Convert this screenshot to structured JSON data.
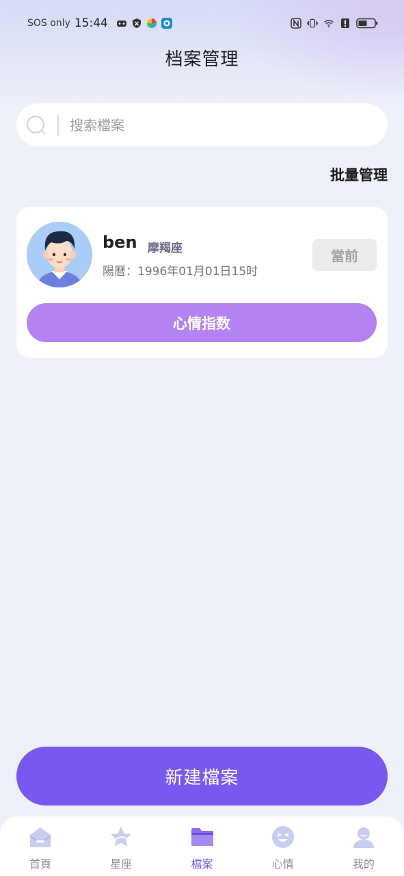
{
  "status_bar": {
    "carrier": "SOS only",
    "time": "15:44"
  },
  "header": {
    "title": "档案管理"
  },
  "search": {
    "placeholder": "搜索檔案"
  },
  "batch_manage": "批量管理",
  "profile": {
    "name": "ben",
    "zodiac": "摩羯座",
    "birth": "陽曆：1996年01月01日15时",
    "current_label": "當前",
    "mood_button": "心情指数"
  },
  "new_archive_button": "新建檔案",
  "tabs": [
    {
      "label": "首頁",
      "icon": "home-icon",
      "active": false
    },
    {
      "label": "星座",
      "icon": "star-icon",
      "active": false
    },
    {
      "label": "檔案",
      "icon": "folder-icon",
      "active": true
    },
    {
      "label": "心情",
      "icon": "mood-icon",
      "active": false
    },
    {
      "label": "我的",
      "icon": "user-icon",
      "active": false
    }
  ],
  "colors": {
    "accent": "#7858ee",
    "mood_button": "#b383f2",
    "active_tab": "#7558ea",
    "background": "#eff1fa"
  }
}
